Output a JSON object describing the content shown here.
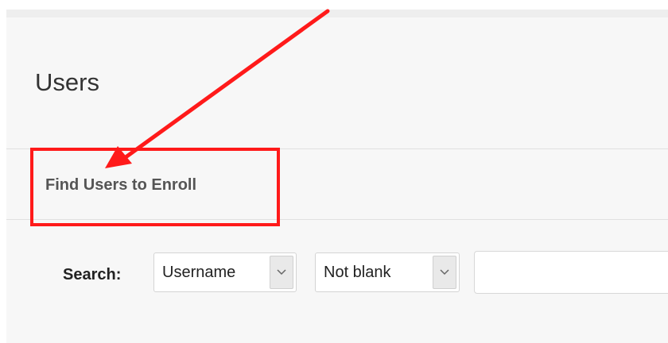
{
  "page": {
    "title": "Users"
  },
  "section": {
    "heading": "Find Users to Enroll"
  },
  "search": {
    "label": "Search:",
    "field_select": {
      "selected": "Username"
    },
    "operator_select": {
      "selected": "Not blank"
    },
    "input": {
      "value": "",
      "placeholder": ""
    }
  },
  "annotation": {
    "color": "#ff1a1a"
  }
}
